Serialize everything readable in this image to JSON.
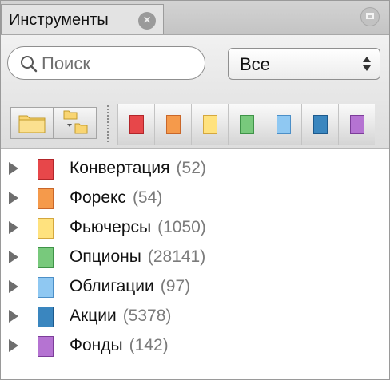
{
  "tab": {
    "title": "Инструменты",
    "close_icon": "close-icon",
    "maximize_icon": "maximize-icon"
  },
  "search": {
    "value": "",
    "placeholder": "Поиск",
    "icon": "search-icon"
  },
  "filter": {
    "selected": "Все"
  },
  "toolbar": {
    "folder_icon": "folder-icon",
    "folder_tree_icon": "folder-tree-icon",
    "category_buttons": [
      {
        "color": "#e7474a",
        "border": "#b2262a"
      },
      {
        "color": "#f59a4b",
        "border": "#c9672a"
      },
      {
        "color": "#ffe27e",
        "border": "#d4a73e"
      },
      {
        "color": "#78c97c",
        "border": "#3f9348"
      },
      {
        "color": "#8fc8f2",
        "border": "#4c8fc7"
      },
      {
        "color": "#3a86bf",
        "border": "#1d5a8d"
      },
      {
        "color": "#b573d2",
        "border": "#7c3d99"
      }
    ]
  },
  "categories": [
    {
      "label": "Конвертация",
      "count": "(52)",
      "color": "#e7474a",
      "border": "#b2262a"
    },
    {
      "label": "Форекс",
      "count": "(54)",
      "color": "#f59a4b",
      "border": "#c9672a"
    },
    {
      "label": "Фьючерсы",
      "count": "(1050)",
      "color": "#ffe27e",
      "border": "#d4a73e"
    },
    {
      "label": "Опционы",
      "count": "(28141)",
      "color": "#78c97c",
      "border": "#3f9348"
    },
    {
      "label": "Облигации",
      "count": "(97)",
      "color": "#8fc8f2",
      "border": "#4c8fc7"
    },
    {
      "label": "Акции",
      "count": "(5378)",
      "color": "#3a86bf",
      "border": "#1d5a8d"
    },
    {
      "label": "Фонды",
      "count": "(142)",
      "color": "#b573d2",
      "border": "#7c3d99"
    }
  ]
}
